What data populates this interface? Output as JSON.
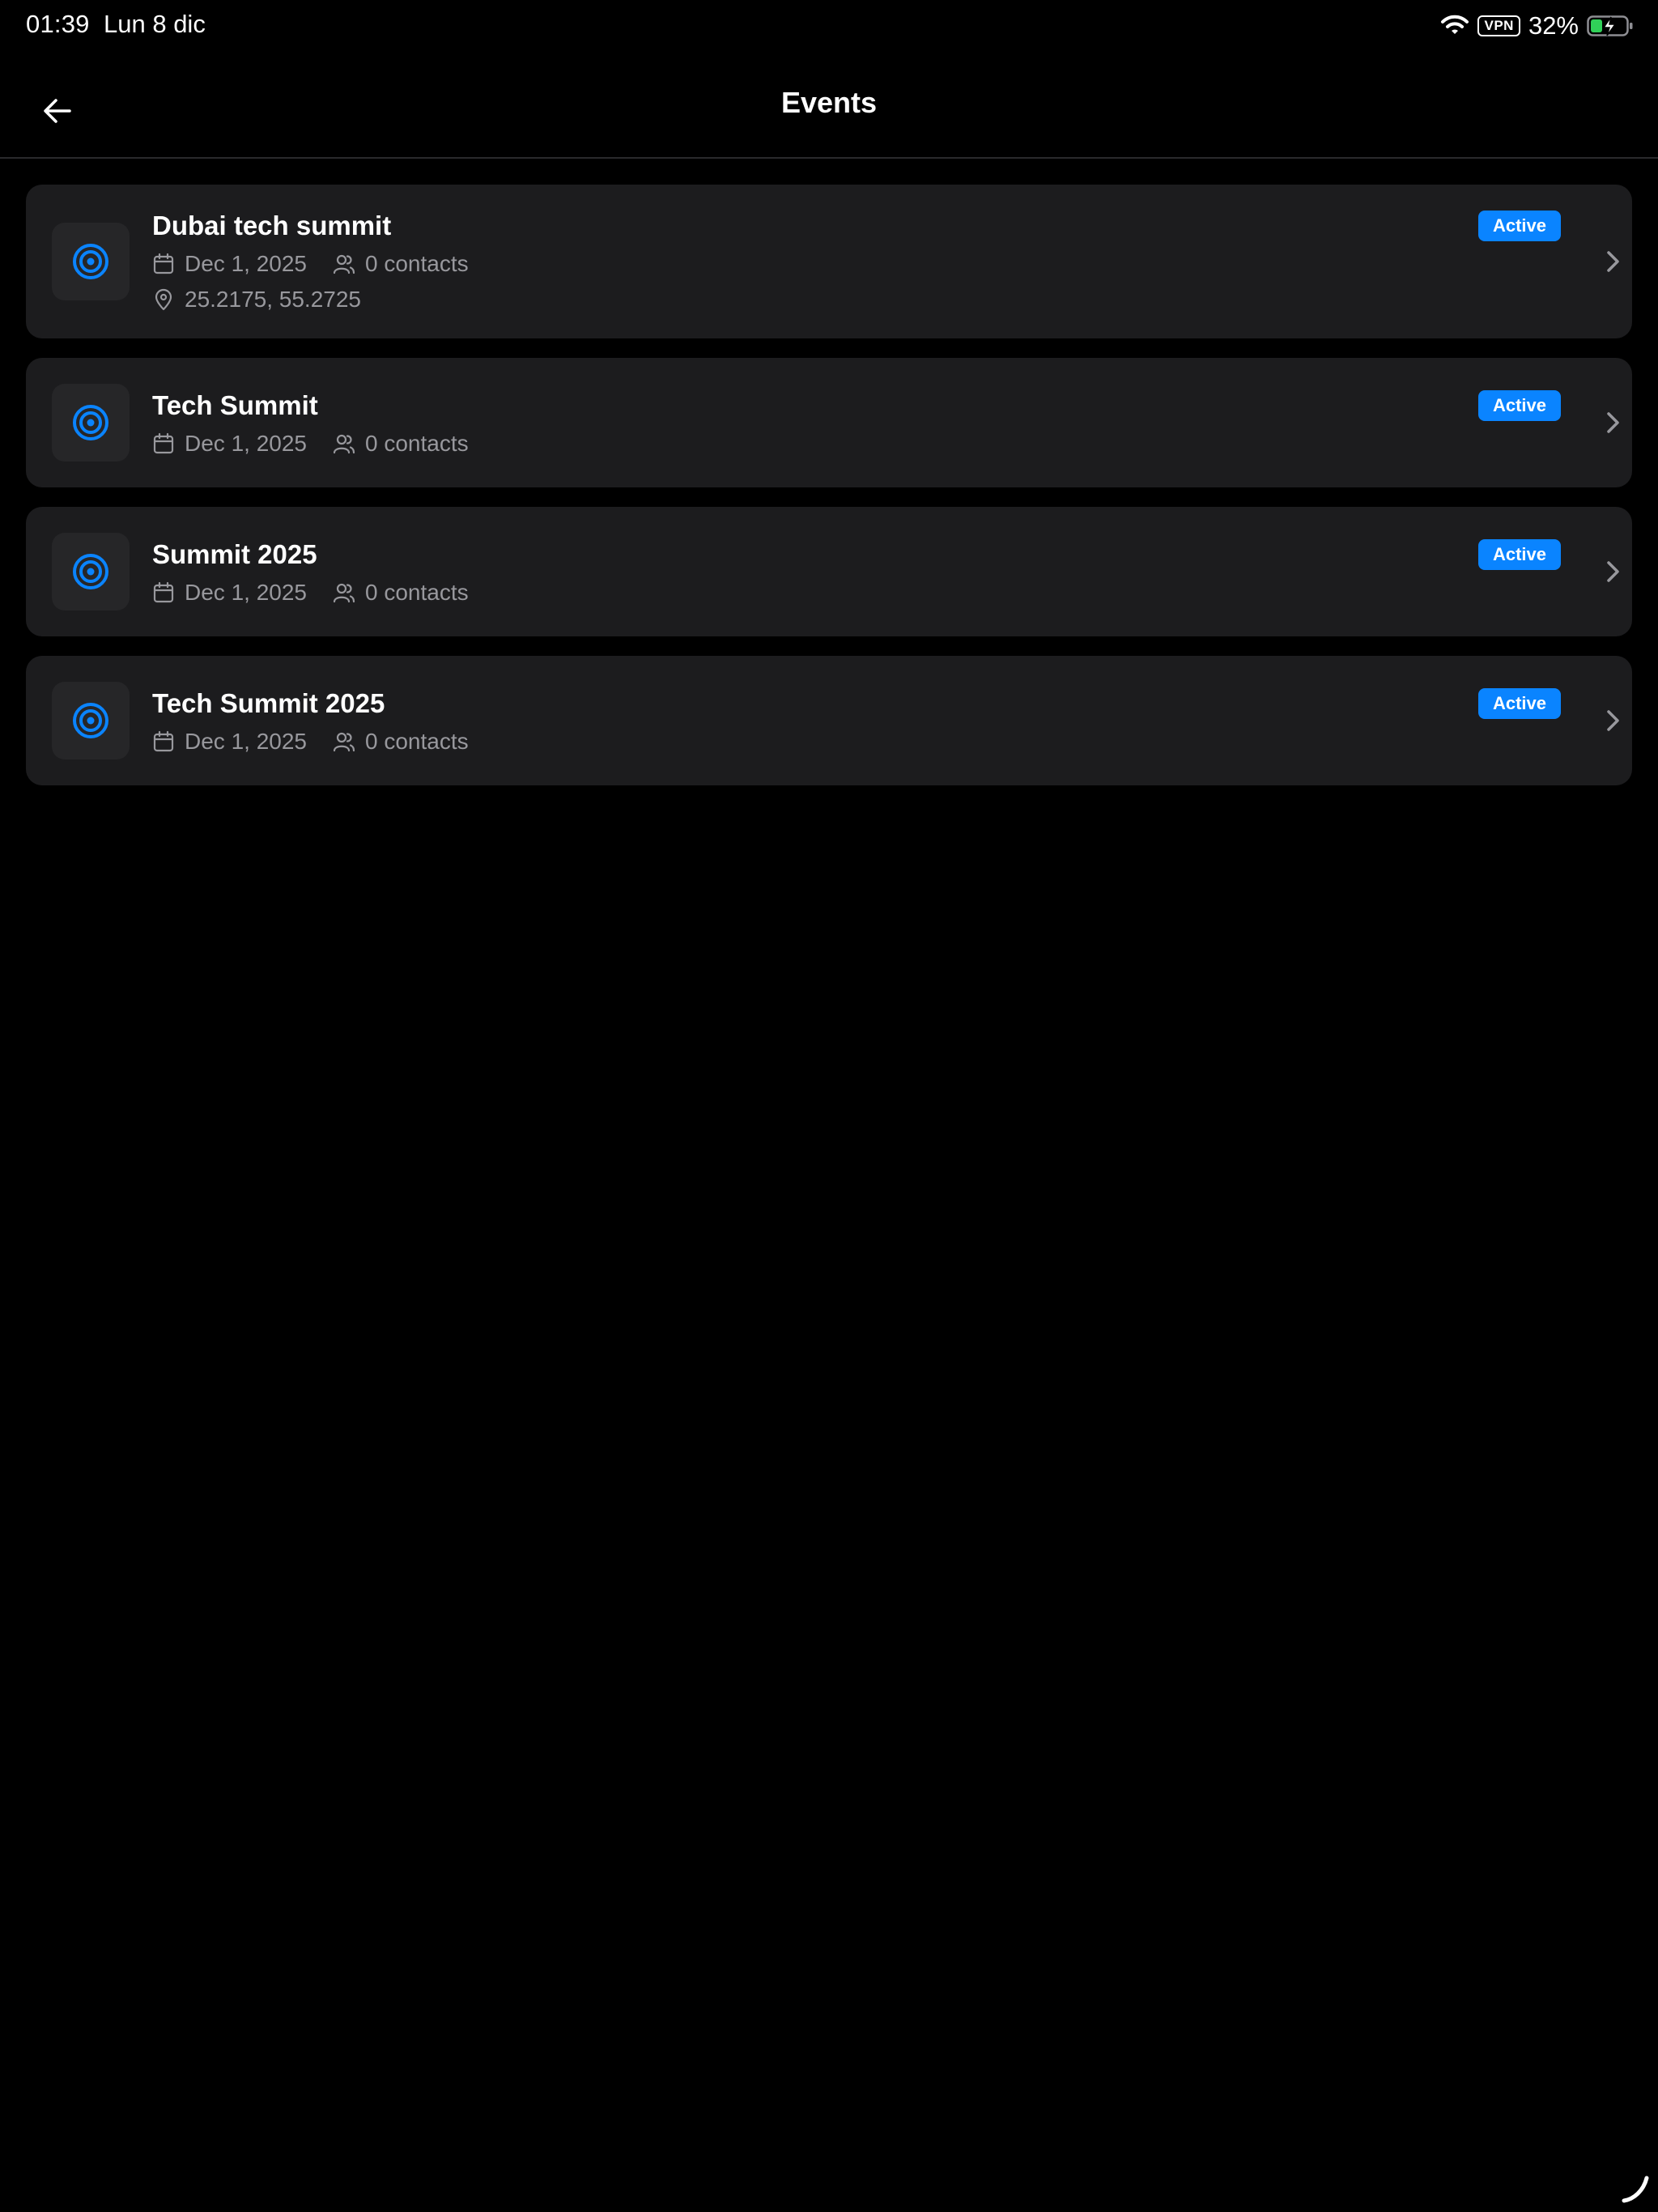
{
  "status_bar": {
    "time": "01:39",
    "date": "Lun 8 dic",
    "vpn": "VPN",
    "battery": "32%"
  },
  "nav": {
    "title": "Events"
  },
  "events": [
    {
      "title": "Dubai tech summit",
      "date": "Dec 1, 2025",
      "contacts": "0 contacts",
      "location": "25.2175, 55.2725",
      "status": "Active"
    },
    {
      "title": "Tech Summit",
      "date": "Dec 1, 2025",
      "contacts": "0 contacts",
      "status": "Active"
    },
    {
      "title": "Summit 2025",
      "date": "Dec 1, 2025",
      "contacts": "0 contacts",
      "status": "Active"
    },
    {
      "title": "Tech Summit 2025",
      "date": "Dec 1, 2025",
      "contacts": "0 contacts",
      "status": "Active"
    }
  ],
  "colors": {
    "background": "#000000",
    "card": "#1c1c1e",
    "accent": "#0a84ff",
    "secondary_text": "#98989d"
  }
}
